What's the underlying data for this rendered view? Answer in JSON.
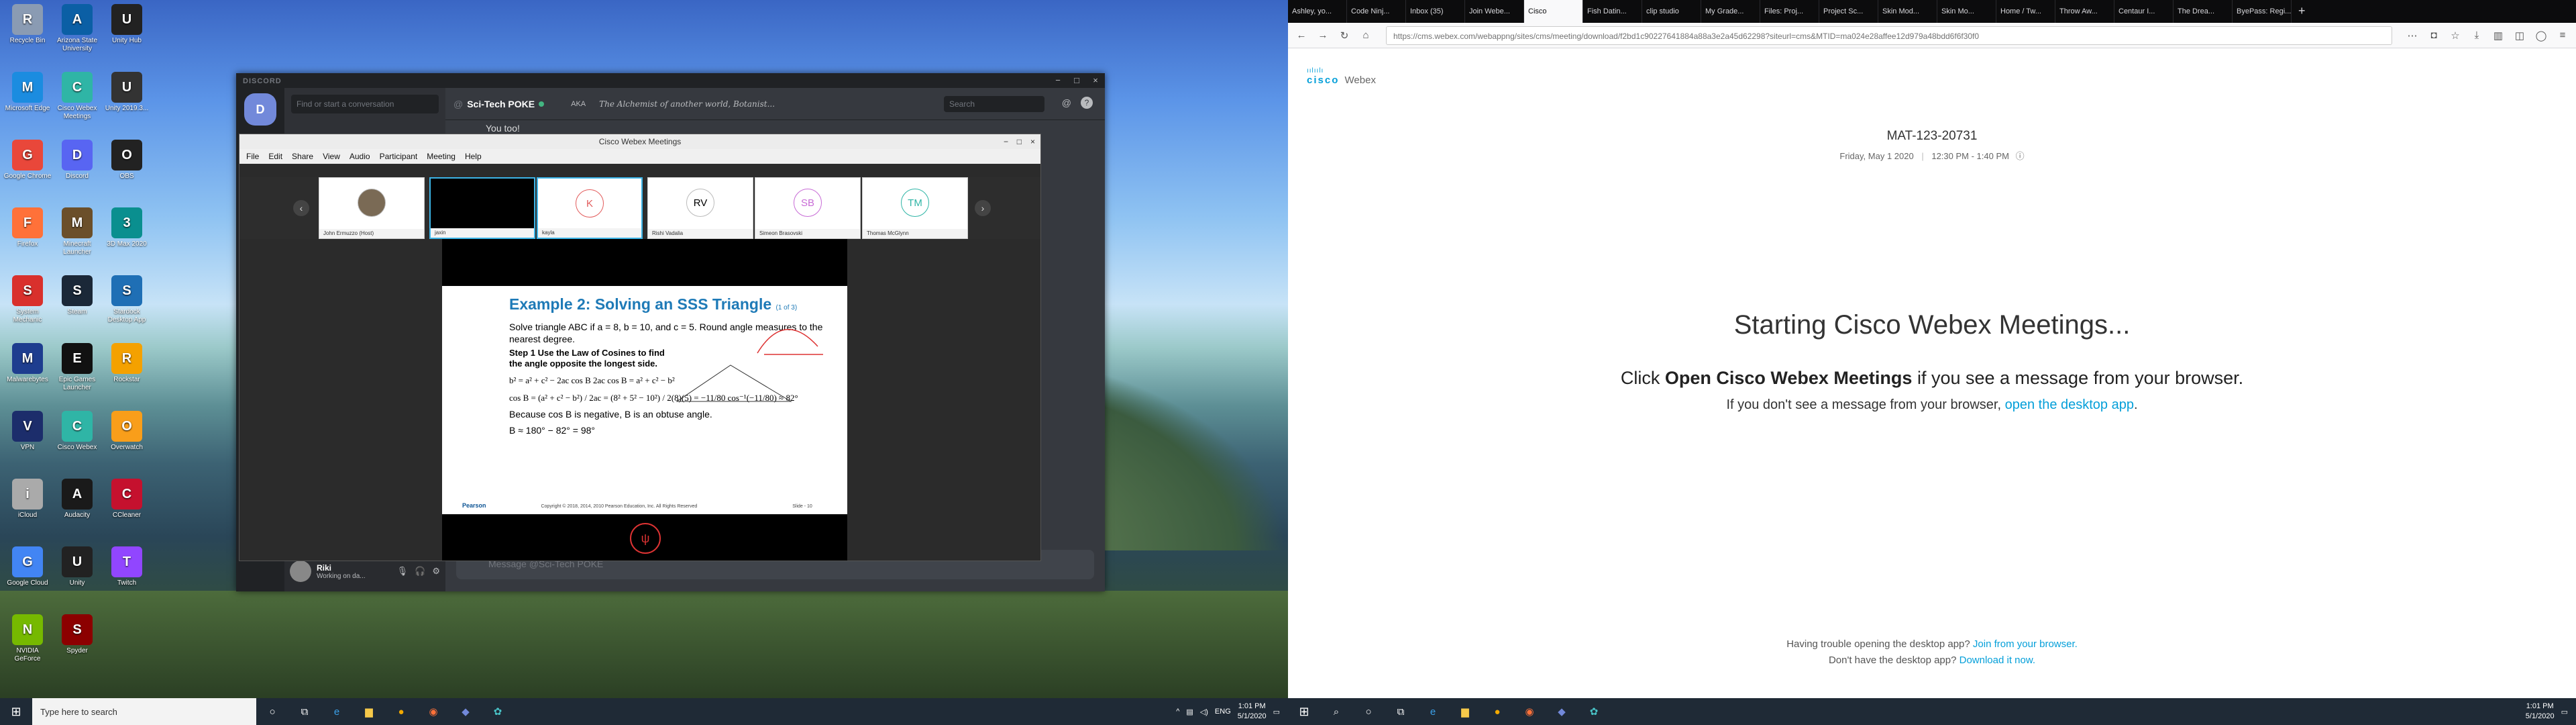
{
  "desktop": {
    "icons": [
      "Recycle Bin",
      "Arizona State University",
      "Unity Hub",
      "Microsoft Edge",
      "Cisco Webex Meetings",
      "Unity 2019.3...",
      "Google Chrome",
      "Discord",
      "OBS",
      "Firefox",
      "Minecraft Launcher",
      "3D Max 2020",
      "System Mechanic",
      "Steam",
      "Stardock Desktop App",
      "Malwarebytes",
      "Epic Games Launcher",
      "Rockstar",
      "VPN",
      "Cisco Webex",
      "Overwatch",
      "iCloud",
      "Audacity",
      "CCleaner",
      "Google Cloud",
      "Unity",
      "Twitch",
      "NVIDIA GeForce",
      "Spyder",
      ""
    ]
  },
  "discord": {
    "window_title": "DISCORD",
    "search_placeholder": "Find or start a conversation",
    "server_initial": "D",
    "channel_name": "Sci-Tech POKE",
    "topic": "The Alchemist of another world, Botanist...",
    "aka": "AKA",
    "search_label": "Search",
    "message": "You too!",
    "input_placeholder": "Message @Sci-Tech POKE",
    "user": {
      "name": "Riki",
      "status": "Working on da..."
    }
  },
  "webex_window": {
    "title": "Cisco Webex Meetings",
    "menu": [
      "File",
      "Edit",
      "Share",
      "View",
      "Audio",
      "Participant",
      "Meeting",
      "Help"
    ],
    "participants": [
      {
        "initials": "",
        "name": "John Ermuzzo (Host)"
      },
      {
        "initials": "",
        "name": "jaxin"
      },
      {
        "initials": "K",
        "name": "kayla"
      },
      {
        "initials": "RV",
        "name": "Rishi Vadalia"
      },
      {
        "initials": "SB",
        "name": "Simeon Brasovski"
      },
      {
        "initials": "TM",
        "name": "Thomas McGlynn"
      }
    ],
    "slide": {
      "title": "Example 2: Solving an SSS Triangle",
      "title_part": "(1 of 3)",
      "problem": "Solve triangle ABC if a = 8, b = 10, and c = 5. Round angle measures to the nearest degree.",
      "step": "Step 1 Use the Law of Cosines to find the angle opposite the longest side.",
      "eq1": "b² = a² + c² − 2ac cos B     2ac cos B = a² + c² − b²",
      "eq2": "cos B = (a² + c² − b²) / 2ac = (8² + 5² − 10²) / 2(8)(5) = −11/80     cos⁻¹(−11/80) ≈ 82°",
      "conclusion": "Because cos B is negative, B is an obtuse angle.",
      "result": "B ≈ 180° − 82° = 98°",
      "publisher": "Pearson",
      "copyright": "Copyright © 2018, 2014, 2010 Pearson Education, Inc. All Rights Reserved",
      "slide_no": "Slide - 10"
    }
  },
  "taskbar": {
    "search_placeholder": "Type here to search",
    "lang": "ENG",
    "time": "1:01 PM",
    "date": "5/1/2020"
  },
  "browser": {
    "tabs": [
      "Ashley, yo...",
      "Code Ninj...",
      "Inbox (35)",
      "Join Webe...",
      "Cisco",
      "Fish Datin...",
      "clip studio",
      "My Grade...",
      "Files: Proj...",
      "Project Sc...",
      "Skin Mod...",
      "Skin Mo...",
      "Home / Tw...",
      "Throw Aw...",
      "Centaur I...",
      "The Drea...",
      "ByePass: Regi..."
    ],
    "active_tab": 4,
    "url": "https://cms.webex.com/webappng/sites/cms/meeting/download/f2bd1c90227641884a88a3e2a45d62298?siteurl=cms&MTID=ma024e28affee12d979a48bdd6f6f30f0"
  },
  "webex_page": {
    "logo_brand": "cisco",
    "logo_product": "Webex",
    "meeting_id": "MAT-123-20731",
    "meeting_date": "Friday, May 1 2020",
    "meeting_time": "12:30 PM - 1:40 PM",
    "heading": "Starting Cisco Webex Meetings...",
    "click_pre": "Click ",
    "click_bold": "Open Cisco Webex Meetings",
    "click_post": " if you see a message from your browser.",
    "desktop_pre": "If you don't see a message from your browser, ",
    "desktop_link": "open the desktop app",
    "desktop_post": ".",
    "trouble_pre": "Having trouble opening the desktop app? ",
    "trouble_link": "Join from your browser.",
    "download_pre": "Don't have the desktop app? ",
    "download_link": "Download it now."
  }
}
